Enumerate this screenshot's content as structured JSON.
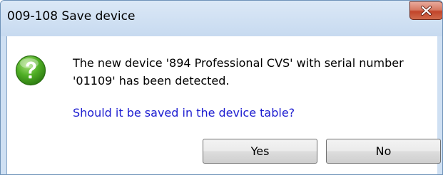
{
  "window": {
    "title": "009-108 Save device"
  },
  "icons": {
    "question": "question-icon",
    "close": "close-icon"
  },
  "message": {
    "line1": "The new device '894 Professional CVS' with serial number",
    "line2": "'01109' has been detected.",
    "question": "Should it be saved in the device table?"
  },
  "buttons": {
    "yes": "Yes",
    "no": "No"
  },
  "colors": {
    "question_text": "#1c1cd0",
    "close_button": "#c2452a",
    "icon_green": "#3a9a1a"
  }
}
